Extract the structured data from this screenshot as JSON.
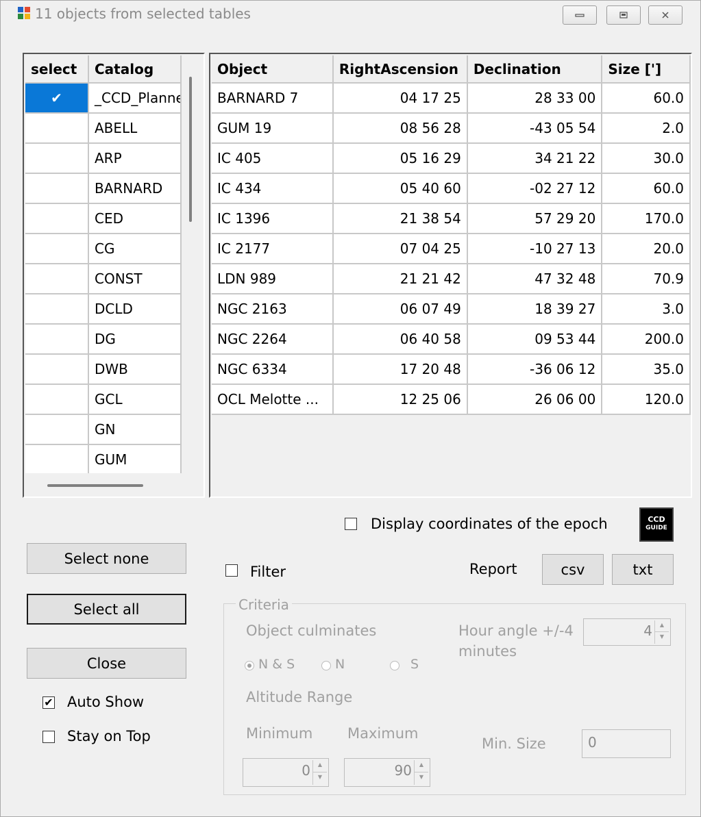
{
  "window": {
    "title": "11 objects from selected tables",
    "icon": "app-grid-icon",
    "minimize_icon": "minimize-icon",
    "restore_icon": "restore-icon",
    "close_icon": "close-icon"
  },
  "catalog_table": {
    "headers": {
      "select": "select",
      "catalog": "Catalog"
    },
    "rows": [
      {
        "selected": true,
        "catalog": "_CCD_Planne"
      },
      {
        "selected": false,
        "catalog": "ABELL"
      },
      {
        "selected": false,
        "catalog": "ARP"
      },
      {
        "selected": false,
        "catalog": "BARNARD"
      },
      {
        "selected": false,
        "catalog": "CED"
      },
      {
        "selected": false,
        "catalog": "CG"
      },
      {
        "selected": false,
        "catalog": "CONST"
      },
      {
        "selected": false,
        "catalog": "DCLD"
      },
      {
        "selected": false,
        "catalog": "DG"
      },
      {
        "selected": false,
        "catalog": "DWB"
      },
      {
        "selected": false,
        "catalog": "GCL"
      },
      {
        "selected": false,
        "catalog": "GN"
      },
      {
        "selected": false,
        "catalog": "GUM"
      }
    ],
    "check_glyph": "✔"
  },
  "objects_table": {
    "headers": {
      "object": "Object",
      "ra": "RightAscension",
      "dec": "Declination",
      "size": "Size [']"
    },
    "rows": [
      {
        "object": "BARNARD 7",
        "ra": "04 17 25",
        "dec": "28 33 00",
        "size": "60.0"
      },
      {
        "object": "GUM 19",
        "ra": "08 56 28",
        "dec": "-43 05 54",
        "size": "2.0"
      },
      {
        "object": "IC 405",
        "ra": "05 16 29",
        "dec": "34 21 22",
        "size": "30.0"
      },
      {
        "object": "IC 434",
        "ra": "05 40 60",
        "dec": "-02 27 12",
        "size": "60.0"
      },
      {
        "object": "IC 1396",
        "ra": "21 38 54",
        "dec": "57 29 20",
        "size": "170.0"
      },
      {
        "object": "IC 2177",
        "ra": "07 04 25",
        "dec": "-10 27 13",
        "size": "20.0"
      },
      {
        "object": "LDN 989",
        "ra": "21 21 42",
        "dec": "47 32 48",
        "size": "70.9"
      },
      {
        "object": "NGC 2163",
        "ra": "06 07 49",
        "dec": "18 39 27",
        "size": "3.0"
      },
      {
        "object": "NGC 2264",
        "ra": "06 40 58",
        "dec": "09 53 44",
        "size": "200.0"
      },
      {
        "object": "NGC 6334",
        "ra": "17 20 48",
        "dec": "-36 06 12",
        "size": "35.0"
      },
      {
        "object": "OCL Melotte ...",
        "ra": "12 25 06",
        "dec": "26 06 00",
        "size": "120.0"
      }
    ]
  },
  "controls": {
    "display_epoch_label": "Display coordinates of the epoch",
    "display_epoch_checked": false,
    "select_none": "Select none",
    "select_all": "Select all",
    "close": "Close",
    "auto_show_label": "Auto Show",
    "auto_show_checked": true,
    "stay_on_top_label": "Stay on Top",
    "stay_on_top_checked": false,
    "filter_label": "Filter",
    "filter_checked": false,
    "report_label": "Report",
    "csv": "csv",
    "txt": "txt",
    "logo_line1": "CCD",
    "logo_line2": "GUIDE",
    "checkmark": "✔"
  },
  "criteria": {
    "title": "Criteria",
    "culminates_label": "Object culminates",
    "radio_ns": "N & S",
    "radio_n": "N",
    "radio_s": "S",
    "hour_angle_label": "Hour angle +/-4",
    "minutes_label": "minutes",
    "hour_angle_value": "4",
    "altitude_label": "Altitude Range",
    "minimum_label": "Minimum",
    "maximum_label": "Maximum",
    "min_value": "0",
    "max_value": "90",
    "min_size_label": "Min. Size",
    "min_size_value": "0"
  }
}
